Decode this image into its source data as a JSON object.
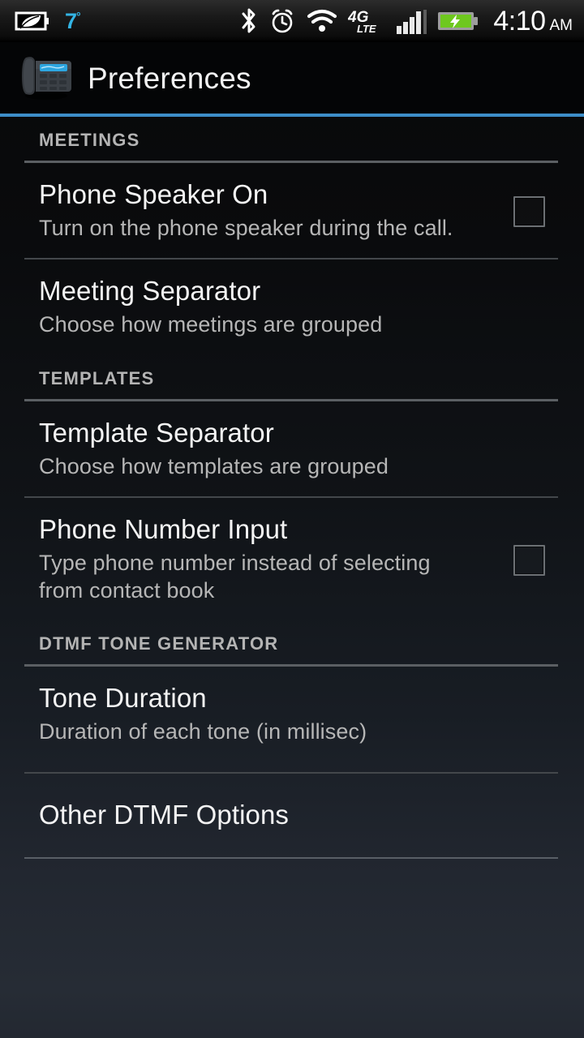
{
  "status_bar": {
    "left_icons": [
      {
        "name": "eco-battery-icon",
        "label": "eco-mode"
      },
      {
        "name": "temperature-indicator",
        "value": "7",
        "unit": "°",
        "color": "#33b5e5"
      }
    ],
    "right_icons": [
      {
        "name": "bluetooth-icon",
        "label": "bluetooth"
      },
      {
        "name": "alarm-clock-icon",
        "label": "alarm"
      },
      {
        "name": "wifi-icon",
        "label": "wifi"
      },
      {
        "name": "network-4glte-icon",
        "label": "4G LTE",
        "primary": "4G",
        "secondary": "LTE"
      },
      {
        "name": "signal-bars-icon",
        "label": "cellular-signal",
        "bars": 4
      },
      {
        "name": "battery-charging-icon",
        "label": "battery-charging",
        "color": "#6ec81e"
      }
    ],
    "clock": {
      "time": "4:10",
      "ampm": "AM"
    }
  },
  "action_bar": {
    "icon": "desk-phone-icon",
    "title": "Preferences",
    "accent_color": "#3d8ec9"
  },
  "sections": [
    {
      "header": "MEETINGS",
      "items": [
        {
          "title": "Phone Speaker On",
          "summary": "Turn on the phone speaker during the call.",
          "widget": "checkbox",
          "checked": false
        },
        {
          "title": "Meeting Separator",
          "summary": "Choose how meetings are grouped",
          "widget": "none"
        }
      ]
    },
    {
      "header": "TEMPLATES",
      "items": [
        {
          "title": "Template Separator",
          "summary": "Choose how templates are grouped",
          "widget": "none"
        },
        {
          "title": "Phone Number Input",
          "summary": "Type phone number instead of selecting from contact book",
          "widget": "checkbox",
          "checked": false
        }
      ]
    },
    {
      "header": "DTMF TONE GENERATOR",
      "items": [
        {
          "title": "Tone Duration",
          "summary": "Duration of each tone (in millisec)",
          "widget": "none"
        },
        {
          "title": "Other DTMF Options",
          "summary": "",
          "widget": "none"
        }
      ]
    }
  ]
}
